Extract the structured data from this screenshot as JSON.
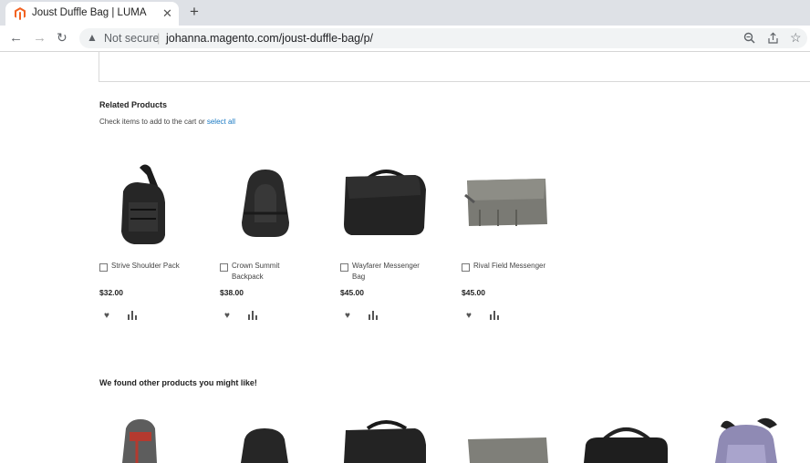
{
  "browser": {
    "tab_title": "Joust Duffle Bag | LUMA",
    "close_symbol": "✕",
    "new_tab_symbol": "+",
    "security_label": "Not secure",
    "url": "johanna.magento.com/joust-duffle-bag/p/"
  },
  "related": {
    "heading": "Related Products",
    "hint_text": "Check items to add to the cart or ",
    "select_all_label": "select all",
    "products": [
      {
        "name": "Strive Shoulder Pack",
        "price": "$32.00"
      },
      {
        "name": "Crown Summit Backpack",
        "price": "$38.00"
      },
      {
        "name": "Wayfarer Messenger Bag",
        "price": "$45.00"
      },
      {
        "name": "Rival Field Messenger",
        "price": "$45.00"
      }
    ]
  },
  "recommendations": {
    "heading": "We found other products you might like!"
  },
  "colors": {
    "link": "#1979c3",
    "tab_strip": "#dee1e6",
    "favicon": "#f26322"
  }
}
